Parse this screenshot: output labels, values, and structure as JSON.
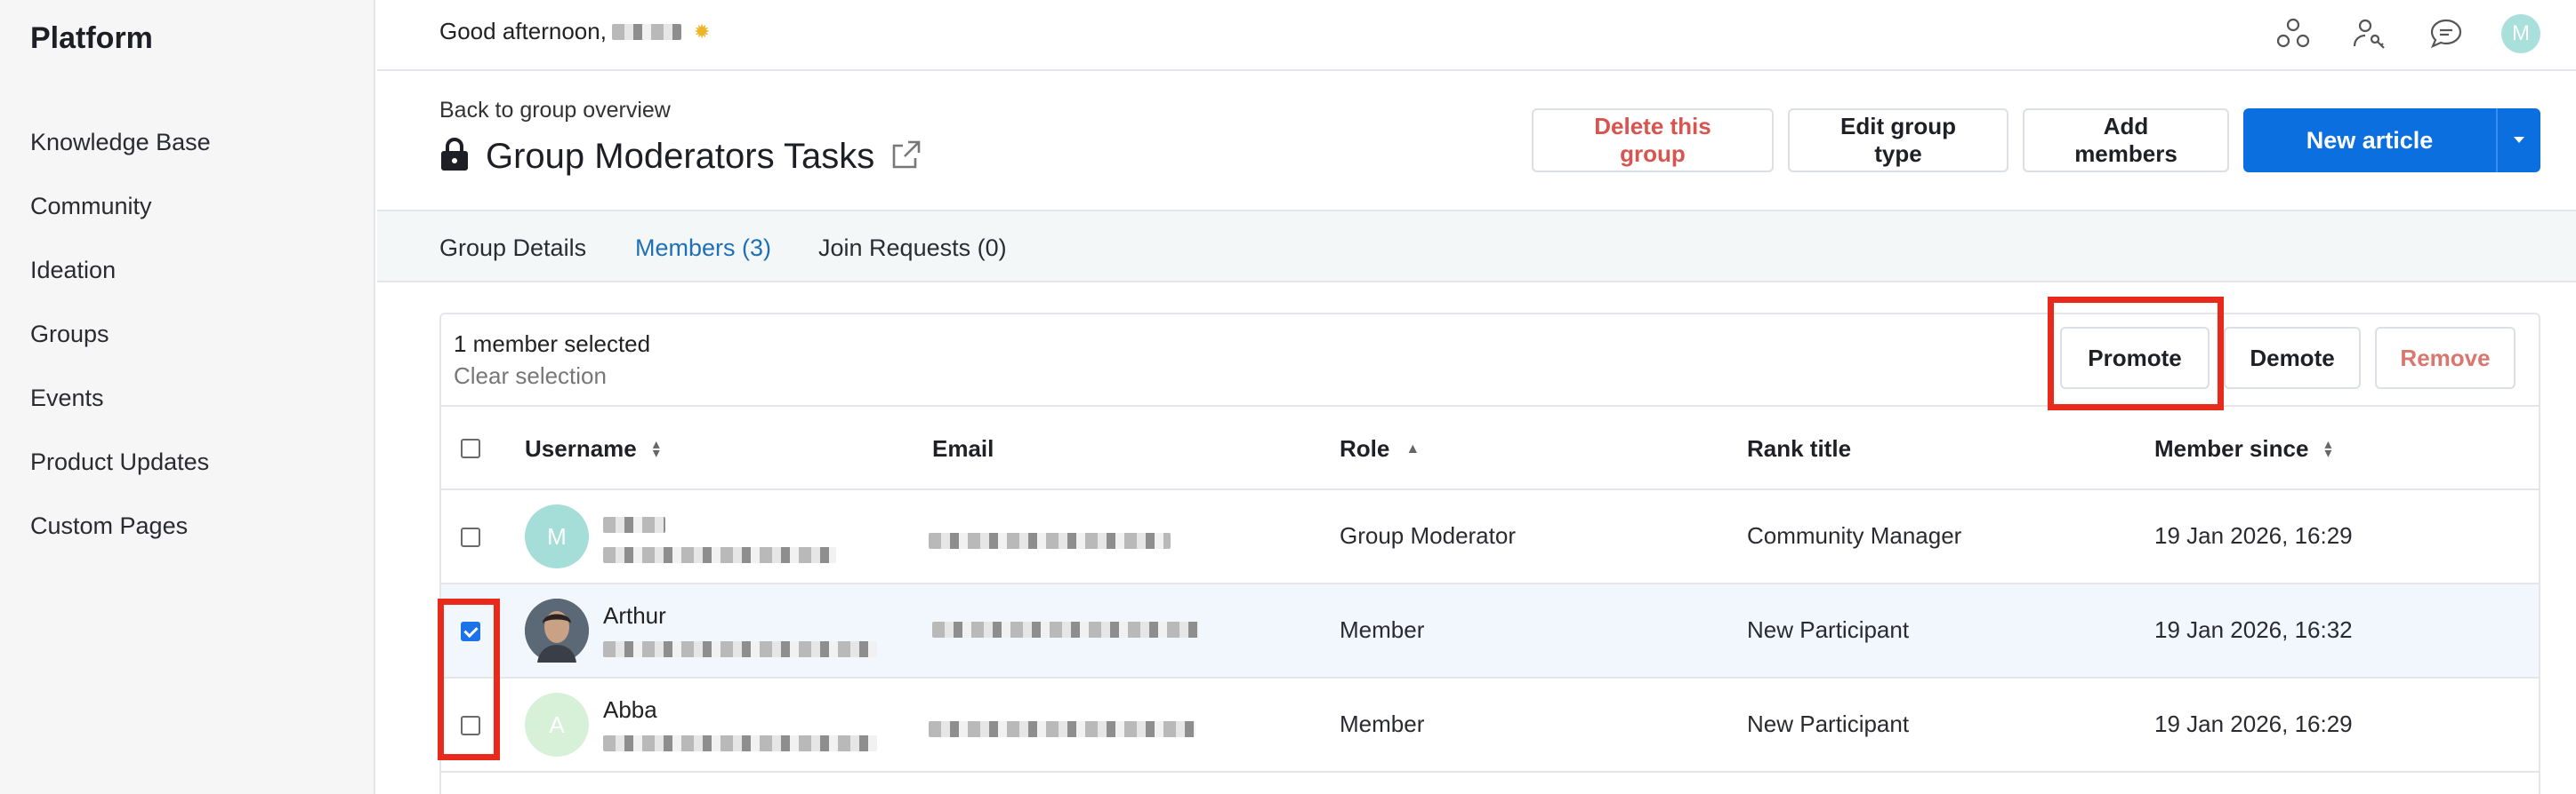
{
  "sidebar": {
    "brand": "Platform",
    "items": [
      {
        "label": "Knowledge Base"
      },
      {
        "label": "Community"
      },
      {
        "label": "Ideation"
      },
      {
        "label": "Groups"
      },
      {
        "label": "Events"
      },
      {
        "label": "Product Updates"
      },
      {
        "label": "Custom Pages"
      }
    ]
  },
  "topbar": {
    "greeting": "Good afternoon,",
    "avatar_initial": "M",
    "icons": [
      "community-icon",
      "user-key-icon",
      "chat-icon",
      "avatar"
    ]
  },
  "header": {
    "back_label": "Back to group overview",
    "title": "Group Moderators Tasks",
    "buttons": {
      "delete": "Delete this group",
      "edit_type": "Edit group type",
      "add_members": "Add members",
      "new_article": "New article"
    }
  },
  "tabs": [
    {
      "label": "Group Details",
      "active": false
    },
    {
      "label": "Members (3)",
      "active": true
    },
    {
      "label": "Join Requests (0)",
      "active": false
    }
  ],
  "selection": {
    "count_label": "1 member selected",
    "clear_label": "Clear selection",
    "promote": "Promote",
    "demote": "Demote",
    "remove": "Remove"
  },
  "table": {
    "columns": [
      "Username",
      "Email",
      "Role",
      "Rank title",
      "Member since"
    ],
    "rows": [
      {
        "avatar_initial": "M",
        "name": "",
        "role": "Group Moderator",
        "rank": "Community Manager",
        "since": "19 Jan 2026, 16:29",
        "checked": false
      },
      {
        "avatar_initial": "",
        "name": "Arthur",
        "role": "Member",
        "rank": "New Participant",
        "since": "19 Jan 2026, 16:32",
        "checked": true
      },
      {
        "avatar_initial": "A",
        "name": "Abba",
        "role": "Member",
        "rank": "New Participant",
        "since": "19 Jan 2026, 16:29",
        "checked": false
      }
    ]
  },
  "colors": {
    "primary": "#0b6fe0",
    "danger": "#d9534f",
    "highlight": "#e8291c",
    "active_tab": "#1e6fb4"
  }
}
